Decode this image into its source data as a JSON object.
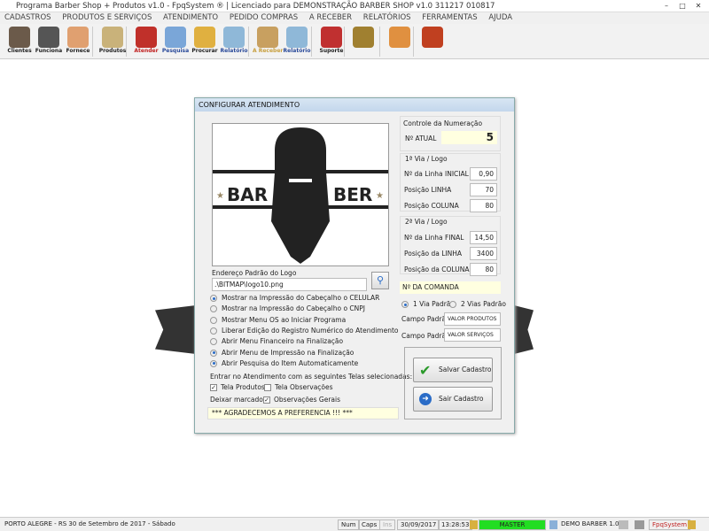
{
  "window": {
    "title": "Programa Barber Shop + Produtos v1.0 - FpqSystem ® | Licenciado para  DEMONSTRAÇÃO BARBER SHOP v1.0 311217 010817"
  },
  "menu": [
    "CADASTROS",
    "PRODUTOS E SERVIÇOS",
    "ATENDIMENTO",
    "PEDIDO COMPRAS",
    "A RECEBER",
    "RELATÓRIOS",
    "FERRAMENTAS",
    "AJUDA"
  ],
  "toolbar": [
    {
      "label": "Clientes",
      "icon": "clients-icon",
      "color": "#6b5a4a"
    },
    {
      "label": "Funciona",
      "icon": "employee-icon",
      "color": "#555"
    },
    {
      "label": "Fornece",
      "icon": "supplier-icon",
      "color": "#e0a070"
    },
    {
      "label": "Produtos",
      "icon": "products-icon",
      "color": "#c9b27a"
    },
    {
      "label": "Atender",
      "icon": "service-icon",
      "color": "#c0302a"
    },
    {
      "label": "Pesquisa",
      "icon": "search-icon",
      "color": "#7aa6d8"
    },
    {
      "label": "Procurar",
      "icon": "folder-icon",
      "color": "#e0b040"
    },
    {
      "label": "Relatório",
      "icon": "printer-icon",
      "color": "#8fb8d8"
    },
    {
      "label": "A Receber",
      "icon": "receivables-icon",
      "color": "#c8a060"
    },
    {
      "label": "Relatório",
      "icon": "printer-icon",
      "color": "#8fb8d8"
    },
    {
      "label": "Suporte",
      "icon": "support-icon",
      "color": "#c03030"
    },
    {
      "label": "",
      "icon": "coin-icon",
      "color": "#a08030"
    },
    {
      "label": "",
      "icon": "calculator-icon",
      "color": "#e09040"
    },
    {
      "label": "",
      "icon": "exit-icon",
      "color": "#c04020"
    }
  ],
  "dialog": {
    "title": "CONFIGURAR ATENDIMENTO",
    "logo_text_left": "BAR",
    "logo_text_right": "BER",
    "logo_path_label": "Endereço Padrão do Logo",
    "logo_path": ".\\BITMAP\\logo10.png",
    "options": [
      {
        "label": "Mostrar na Impressão do Cabeçalho o CELULAR",
        "checked": true
      },
      {
        "label": "Mostrar na Impressão do Cabeçalho o CNPJ",
        "checked": false
      },
      {
        "label": "Mostrar Menu OS ao Iniciar Programa",
        "checked": false
      },
      {
        "label": "Liberar Edição do Registro Numérico do Atendimento",
        "checked": false
      },
      {
        "label": "Abrir Menu Financeiro na Finalização",
        "checked": false
      },
      {
        "label": "Abrir Menu de Impressão na Finalização",
        "checked": true
      },
      {
        "label": "Abrir Pesquisa do Item Automaticamente",
        "checked": true
      }
    ],
    "screens_label": "Entrar no Atendimento com as seguintes Telas selecionadas:",
    "tela_produtos": {
      "label": "Tela Produtos",
      "checked": true
    },
    "tela_observacoes": {
      "label": "Tela Observações",
      "checked": false
    },
    "deixar_marcado": "Deixar marcado:",
    "observacoes_gerais": {
      "label": "Observações Gerais",
      "checked": true
    },
    "footer_message": "*** AGRADECEMOS A PREFERENCIA !!! ***",
    "numeracao": {
      "title": "Controle da Numeração",
      "label": "Nº ATUAL",
      "value": "5"
    },
    "via1": {
      "title": "1ª Via / Logo",
      "rows": [
        {
          "label": "Nº da Linha INICIAL",
          "value": "0,90"
        },
        {
          "label": "Posição LINHA",
          "value": "70"
        },
        {
          "label": "Posição COLUNA",
          "value": "80"
        }
      ]
    },
    "via2": {
      "title": "2ª Via / Logo",
      "rows": [
        {
          "label": "Nº da Linha FINAL",
          "value": "14,50"
        },
        {
          "label": "Posição da LINHA",
          "value": "3400"
        },
        {
          "label": "Posição da COLUNA",
          "value": "80"
        }
      ]
    },
    "comanda": "Nº DA COMANDA",
    "via_options": [
      {
        "label": "1 Via Padrão",
        "checked": true
      },
      {
        "label": "2 Vias Padrão",
        "checked": false
      }
    ],
    "campo1": {
      "label": "Campo Padrão",
      "value": "VALOR PRODUTOS"
    },
    "campo2": {
      "label": "Campo Padrão",
      "value": "VALOR SERVIÇOS"
    },
    "save_label": "Salvar Cadastro",
    "exit_label": "Sair Cadastro"
  },
  "status": {
    "location": "PORTO ALEGRE - RS 30 de Setembro de 2017 - Sábado",
    "num": "Num",
    "caps": "Caps",
    "ins": "Ins",
    "date": "30/09/2017",
    "time": "13:28:53",
    "user": "MASTER",
    "user_color": "#22dd22",
    "version": "DEMO BARBER 1.0",
    "brand": "FpqSystem"
  }
}
